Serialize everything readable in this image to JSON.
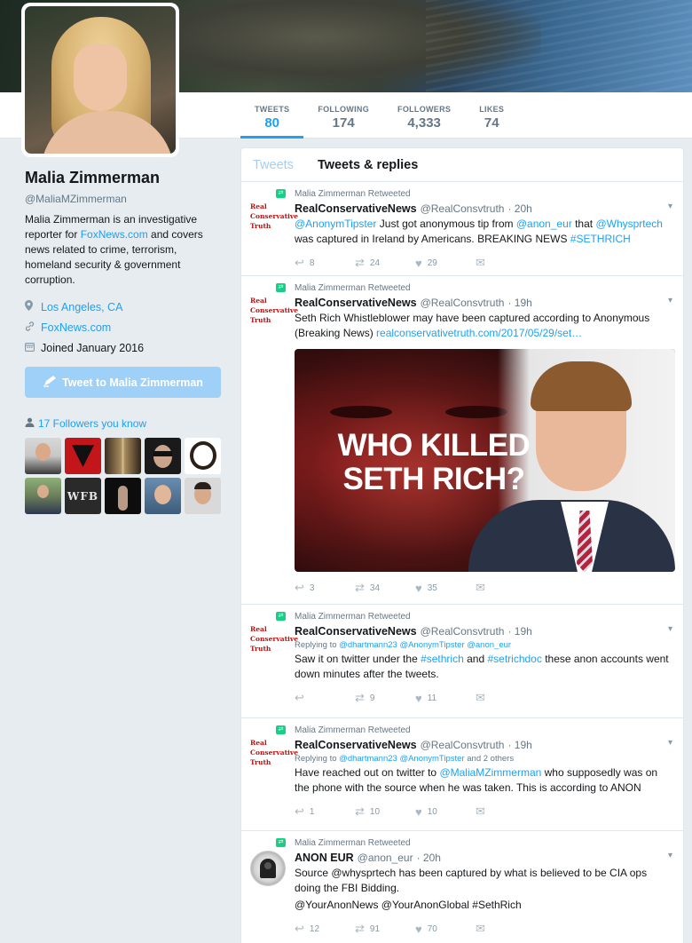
{
  "profile": {
    "name": "Malia Zimmerman",
    "handle": "@MaliaMZimmerman",
    "bio_pre": "Malia Zimmerman is an investigative reporter for ",
    "bio_link": "FoxNews.com",
    "bio_post": " and covers news related to crime, terrorism, homeland security & government corruption.",
    "location": "Los Angeles, CA",
    "website": "FoxNews.com",
    "joined": "Joined January 2016",
    "tweet_to_label": "Tweet to Malia Zimmerman",
    "followers_you_know": "17 Followers you know"
  },
  "stats": [
    {
      "label": "TWEETS",
      "value": "80"
    },
    {
      "label": "FOLLOWING",
      "value": "174"
    },
    {
      "label": "FOLLOWERS",
      "value": "4,333"
    },
    {
      "label": "LIKES",
      "value": "74"
    }
  ],
  "tabs": {
    "tweets": "Tweets",
    "tweets_replies": "Tweets & replies"
  },
  "avatar_logo_text": "Real Conservative Truth",
  "tweets": [
    {
      "retweeted_by": "Malia Zimmerman Retweeted",
      "display_name": "RealConservativeNews",
      "username": "@RealConsvtruth",
      "time": "· 20h",
      "mention1": "@AnonymTipster",
      "text1": " Just got anonymous tip from ",
      "mention2": "@anon_eur",
      "text2": " that ",
      "mention3": "@Whysprtech",
      "text3": " was captured in Ireland by Americans. BREAKING NEWS ",
      "hashtag": "#SETHRICH",
      "replies": "8",
      "retweets": "24",
      "likes": "29"
    },
    {
      "retweeted_by": "Malia Zimmerman Retweeted",
      "display_name": "RealConservativeNews",
      "username": "@RealConsvtruth",
      "time": "· 19h",
      "text": "Seth Rich Whistleblower may have been captured according to Anonymous (Breaking News) ",
      "link": "realconservativetruth.com/2017/05/29/set…",
      "image_caption_line1": "WHO KILLED",
      "image_caption_line2": "SETH RICH?",
      "replies": "3",
      "retweets": "34",
      "likes": "35"
    },
    {
      "retweeted_by": "Malia Zimmerman Retweeted",
      "display_name": "RealConservativeNews",
      "username": "@RealConsvtruth",
      "time": "· 19h",
      "replying_label": "Replying to ",
      "replying_to": "@dhartmann23 @AnonymTipster @anon_eur",
      "text1": "Saw it on twitter under the ",
      "hashtag1": "#sethrich",
      "text2": " and ",
      "hashtag2": "#setrichdoc",
      "text3": " these anon accounts went down minutes after the tweets.",
      "replies": "",
      "retweets": "9",
      "likes": "11"
    },
    {
      "retweeted_by": "Malia Zimmerman Retweeted",
      "display_name": "RealConservativeNews",
      "username": "@RealConsvtruth",
      "time": "· 19h",
      "replying_label": "Replying to ",
      "replying_to": "@dhartmann23 @AnonymTipster",
      "replying_more": " and 2 others",
      "text1": "Have reached out on twitter to ",
      "mention": "@MaliaMZimmerman",
      "text2": " who supposedly was on the phone with the source when he was taken. This is according to ANON",
      "replies": "1",
      "retweets": "10",
      "likes": "10"
    },
    {
      "retweeted_by": "Malia Zimmerman Retweeted",
      "display_name": "ANON EUR",
      "username": "@anon_eur",
      "time": "· 20h",
      "text": "Source @whysprtech has been captured by what is believed to be CIA ops doing the FBI Bidding.",
      "tags": "@YourAnonNews @YourAnonGlobal #SethRich",
      "replies": "12",
      "retweets": "91",
      "likes": "70"
    }
  ],
  "colors": {
    "accent": "#1da1f2",
    "retweet_green": "#19cf86",
    "background": "#e6ecf0"
  }
}
